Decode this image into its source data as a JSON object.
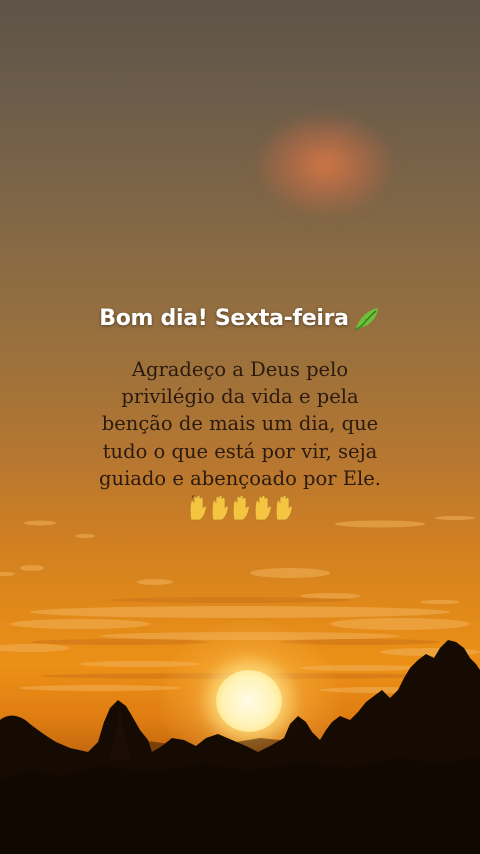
{
  "post": {
    "headline": "Bom dia! Sexta-feira",
    "headline_icon": "leaf-icon",
    "message_lines": [
      "Agradeço a Deus pelo",
      "privilégio da vida e pela",
      "benção de mais um dia, que",
      "tudo o que está por vir, seja",
      "guiado e abençoado por Ele."
    ],
    "emoji_row": [
      "raising-hands-icon",
      "raising-hands-icon",
      "raising-hands-icon",
      "raising-hands-icon",
      "raising-hands-icon"
    ]
  },
  "colors": {
    "headline": "#ffffff",
    "message": "#2a1a10",
    "sky_top": "#5e5348",
    "sky_horizon": "#ec9016",
    "sun": "#fff3b8"
  }
}
